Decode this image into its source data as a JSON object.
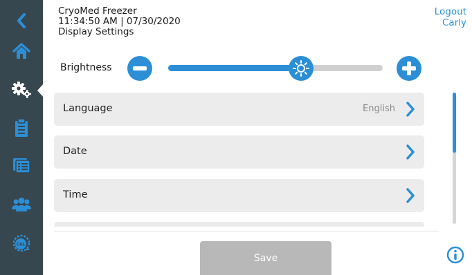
{
  "header": {
    "device_name": "CryoMed Freezer",
    "datetime": "11:34:50 AM | 07/30/2020",
    "page_title": "Display Settings"
  },
  "user": {
    "logout_label": "Logout",
    "username": "Carly"
  },
  "sidebar": {
    "items": [
      {
        "icon": "chevron-left-icon",
        "name": "back"
      },
      {
        "icon": "home-icon",
        "name": "home"
      },
      {
        "icon": "gears-icon",
        "name": "settings",
        "active": true
      },
      {
        "icon": "clipboard-icon",
        "name": "logs"
      },
      {
        "icon": "inventory-icon",
        "name": "inventory"
      },
      {
        "icon": "users-icon",
        "name": "users"
      },
      {
        "icon": "calibration-icon",
        "name": "calibration"
      }
    ]
  },
  "brightness": {
    "label": "Brightness",
    "level": 0.62
  },
  "settings_list": [
    {
      "label": "Language",
      "value": "English"
    },
    {
      "label": "Date",
      "value": ""
    },
    {
      "label": "Time",
      "value": ""
    },
    {
      "label": "",
      "value": ""
    }
  ],
  "scroll": {
    "position_fraction": 0.0,
    "visible_fraction": 0.46
  },
  "actions": {
    "save_label": "Save"
  },
  "colors": {
    "accent": "#2c8fd6",
    "sidebar": "#37474f",
    "row_bg": "#ececec",
    "save_disabled": "#b8b8b8"
  }
}
